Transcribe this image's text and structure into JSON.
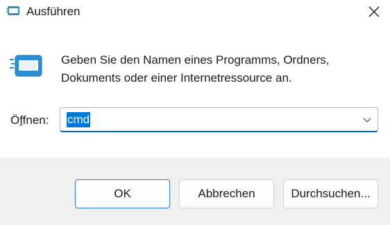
{
  "window": {
    "title": "Ausführen",
    "title_icon": "run-icon",
    "close_icon": "close-icon"
  },
  "main": {
    "icon": "run-icon",
    "description_line1": "Geben Sie den Namen eines Programms, Ordners,",
    "description_line2": "Dokuments oder einer Internetressource an.",
    "open_label_prefix": "Ö",
    "open_label_underlined": "f",
    "open_label_suffix": "fnen:",
    "open_value": "cmd",
    "dropdown_icon": "chevron-down-icon"
  },
  "buttons": {
    "ok_label": "OK",
    "cancel_label": "Abbrechen",
    "browse_label": "Durchsuchen..."
  },
  "colors": {
    "accent": "#0067c0",
    "selection": "#0078d7"
  }
}
